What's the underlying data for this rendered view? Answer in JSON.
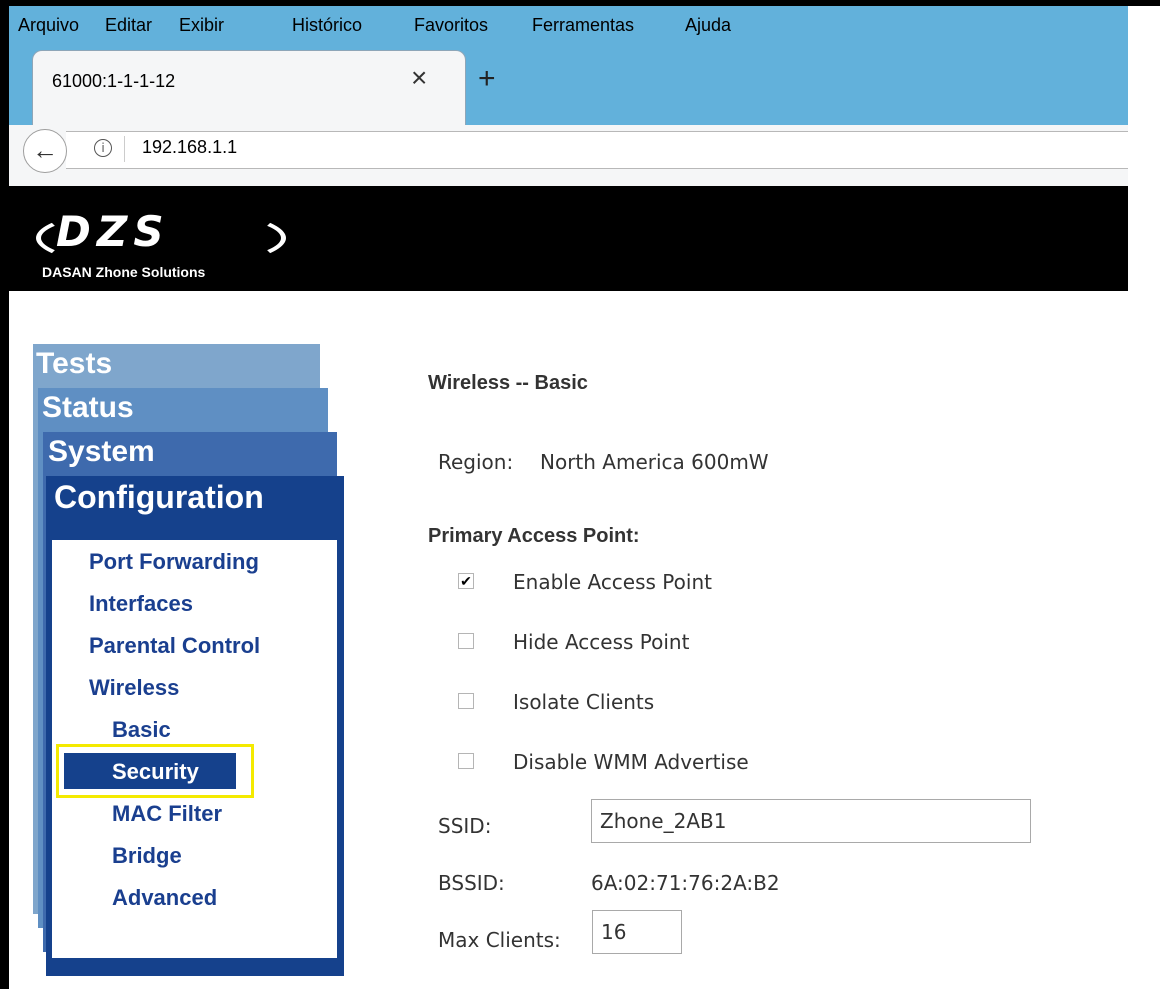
{
  "browser": {
    "menu": [
      "Arquivo",
      "Editar",
      "Exibir",
      "Histórico",
      "Favoritos",
      "Ferramentas",
      "Ajuda"
    ],
    "tab_title": "61000:1-1-1-12",
    "close_glyph": "×",
    "newtab_glyph": "+",
    "url": "192.168.1.1",
    "back_glyph": "←",
    "info_glyph": "i"
  },
  "header": {
    "logo_text": "DZS",
    "logo_subtitle": "DASAN Zhone Solutions"
  },
  "nav": {
    "tabs": [
      "Tests",
      "Status",
      "System",
      "Configuration"
    ],
    "items": [
      "Port Forwarding",
      "Interfaces",
      "Parental Control",
      "Wireless",
      "Basic",
      "Security",
      "MAC Filter",
      "Bridge",
      "Advanced"
    ],
    "selected": "Security"
  },
  "content": {
    "title": "Wireless -- Basic",
    "region_label": "Region:",
    "region_value": "North America  600mW",
    "section": "Primary Access Point:",
    "checkboxes": [
      {
        "label": "Enable Access Point",
        "checked": true
      },
      {
        "label": "Hide Access Point",
        "checked": false
      },
      {
        "label": "Isolate Clients",
        "checked": false
      },
      {
        "label": "Disable WMM Advertise",
        "checked": false
      }
    ],
    "ssid_label": "SSID:",
    "ssid_value": "Zhone_2AB1",
    "bssid_label": "BSSID:",
    "bssid_value": "6A:02:71:76:2A:B2",
    "max_clients_label": "Max Clients:",
    "max_clients_value": "16",
    "check_glyph": "✔"
  },
  "colors": {
    "highlight": "#f4ea00",
    "nav_dark": "#15418c",
    "link": "#1a3f8f"
  }
}
